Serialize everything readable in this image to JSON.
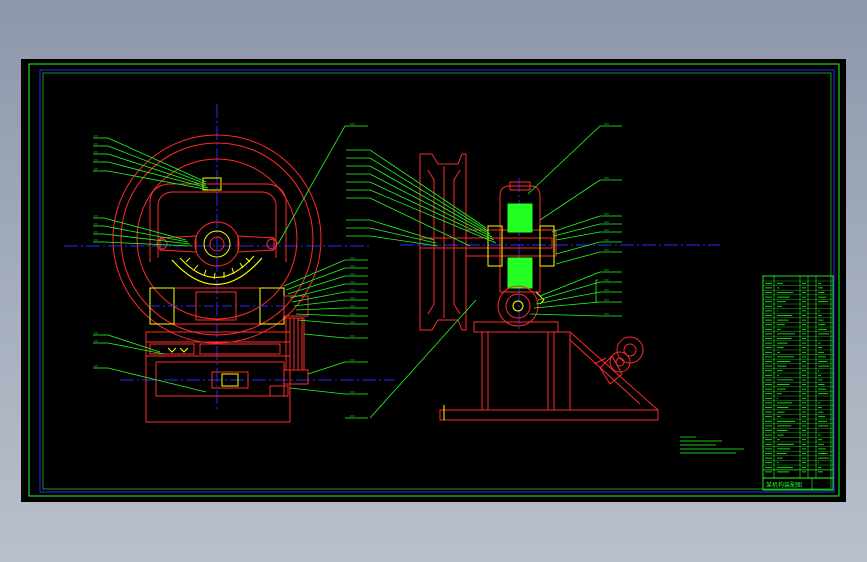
{
  "drawing": {
    "kind": "CAD assembly drawing",
    "background": "#000000",
    "colors": {
      "part_lines": "#ff2a2a",
      "leaders": "#22ff22",
      "centerlines": "#2a2aff",
      "highlight": "#ffff00",
      "sheet_frame": "#22ff22",
      "inner_frame": "#2a2aff"
    },
    "title_block_text": "某机构装配图"
  }
}
